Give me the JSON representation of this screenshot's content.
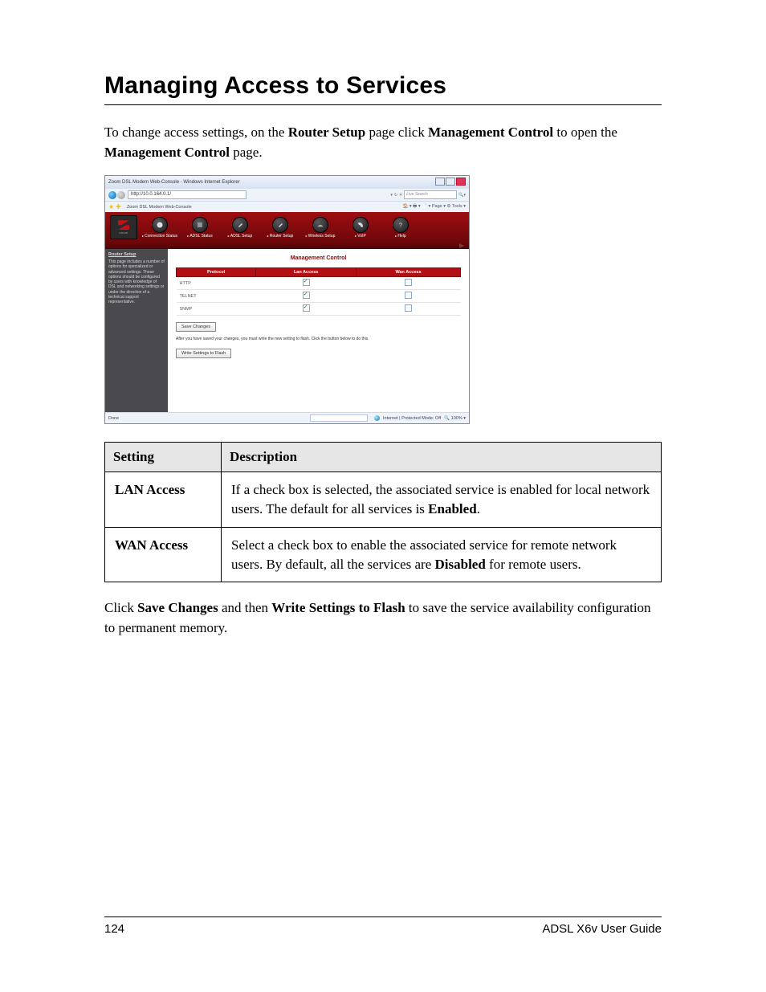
{
  "heading": "Managing Access to Services",
  "intro_pre": "To change access settings, on the ",
  "intro_b1": "Router Setup",
  "intro_mid1": " page click ",
  "intro_b2": "Management Control",
  "intro_mid2": " to open the ",
  "intro_b3": "Management Control",
  "intro_post": " page.",
  "shot": {
    "ie_title": "Zoom DSL Modem Web-Console - Windows Internet Explorer",
    "addr": "http://10.0.164.0.1/",
    "search_ph": "Live Search",
    "tab": "Zoom DSL Modem Web-Console",
    "tools": "🏠 ▾  🖶 ▾  📄 ▾  Page ▾  ⚙ Tools ▾",
    "logo": "zoom",
    "menu": [
      "Connection Status",
      "ADSL Status",
      "ADSL Setup",
      "Router Setup",
      "Wireless Setup",
      "VoIP",
      "Help"
    ],
    "side_title": "Router Setup",
    "side_body": "This page includes a number of options for specialized or advanced settings. These options should be configured by users with knowledge of DSL and networking settings or under the direction of a technical support representative.",
    "mc_title": "Management Control",
    "th1": "Protocol",
    "th2": "Lan Access",
    "th3": "Wan Access",
    "rows": [
      {
        "p": "HTTP",
        "lan": true,
        "wan": false
      },
      {
        "p": "TELNET",
        "lan": true,
        "wan": false
      },
      {
        "p": "SNMP",
        "lan": true,
        "wan": false
      }
    ],
    "save_btn": "Save Changes",
    "note": "After you have saved your changes, you must write the new setting to flash. Click the button below to do this.",
    "write_btn": "Write Settings to Flash",
    "status_done": "Done",
    "status_zone": "Internet | Protected Mode: Off",
    "status_zoom": "🔍 100%  ▾"
  },
  "table": {
    "h1": "Setting",
    "h2": "Description",
    "r1s": "LAN Access",
    "r1a": "If a check box is selected, the associated service is enabled for local network users. The default for all services is ",
    "r1b": "Enabled",
    "r1c": ".",
    "r2s": "WAN Access",
    "r2a": "Select a check box to enable the associated service for remote network users. By default, all the services are ",
    "r2b": "Disabled",
    "r2c": " for remote users."
  },
  "closing_pre": "Click ",
  "closing_b1": "Save Changes",
  "closing_mid": " and then ",
  "closing_b2": "Write Settings to Flash",
  "closing_post": " to save the service availability configuration to permanent memory.",
  "page_num": "124",
  "guide": "ADSL X6v User Guide"
}
